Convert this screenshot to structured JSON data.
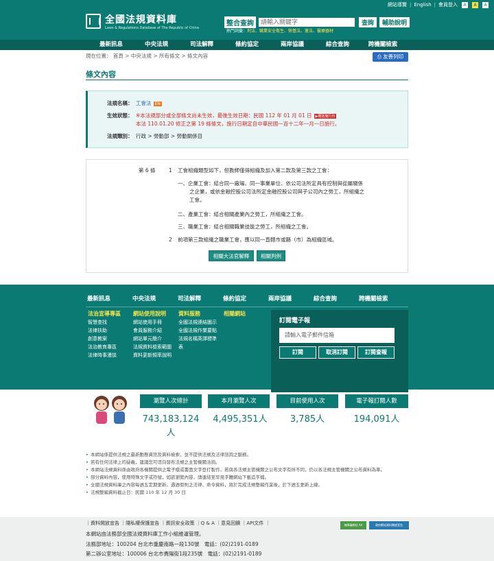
{
  "top": {
    "links": [
      "網站導覽",
      "English",
      "會員登入"
    ],
    "font_sizes": [
      "A",
      "A",
      "A"
    ]
  },
  "logo": {
    "title": "全國法規資料庫",
    "subtitle": "Laws & Regulations Database of The Republic of China"
  },
  "search": {
    "label": "整合查詢",
    "placeholder": "請輸入關鍵字",
    "query_button": "查詢",
    "help_button": "輔助說明",
    "hot_label": "熱門詞彙：",
    "hot_words": "刑法、職業安全衛生、勞基法、憲法、醫療器材"
  },
  "nav": [
    "最新訊息",
    "中央法規",
    "司法解釋",
    "條約協定",
    "兩岸協議",
    "綜合查詢",
    "跨機關檢索"
  ],
  "breadcrumb": "現在位置： 首頁 > 中央法規 > 所有條文 > 條文內容",
  "print_button": "友善列印",
  "page_title": "條文內容",
  "info": {
    "name_label": "法規名稱：",
    "name_value": "工會法",
    "en_badge": "EN",
    "status_label": "生效狀態：",
    "status_line1": "※本法規部分或全部條文尚未生效，最後生效日期：民國 112 年 01 月 01 日",
    "status_badge": "▶概括施行日",
    "status_line2": "本法 110.01.20 修正之第 19 條條文，施行日期定自中華民國一百十二年一月一日施行。",
    "category_label": "法規類別：",
    "category_value": "行政 > 勞動部 > 勞動關係目"
  },
  "article": {
    "number": "第 6 條",
    "para1_no": "1",
    "para1": "工會組織類型如下，但教師僅得組織及加入第二款及第三款之工會：",
    "item1": "一、企業工會：結合同一廠場、同一事業單位、依公司法所定具有控制與從屬關係之企業，或依金融控股公司法所定金融控股公司與子公司內之勞工，所組織之工會。",
    "item1_lines": [
      "一、企業工會：結合同一廠場、同一事業單位、依公司法所定具有控制與從屬關係",
      "之企業，或依金融控股公司法所定金融控股公司與子公司內之勞工，所組織之",
      "工會。"
    ],
    "item2": "二、產業工會：結合相關產業內之勞工，所組織之工會。",
    "item3": "三、職業工會：結合相關職業技能之勞工，所組織之工會。",
    "para2_no": "2",
    "para2": "前項第三款組織之職業工會，應以同一直轄市或縣（市）為組織區域。",
    "btn_interp": "相關大法官解釋",
    "btn_judge": "相關判例"
  },
  "footer": {
    "nav": [
      "最新訊息",
      "中央法規",
      "司法解釋",
      "條約協定",
      "兩岸協議",
      "綜合查詢",
      "跨機關檢索"
    ],
    "col1": {
      "head": "法治宣導專區",
      "items": [
        "智慧查找",
        "法律扶助",
        "創意教案",
        "法治教育專區",
        "法律時事漫談"
      ]
    },
    "col2": {
      "head": "網站使用說明",
      "items": [
        "網站使用手冊",
        "會員服務介紹",
        "網站單元簡介",
        "法規資料檢索範圍",
        "資料更新頻率說明"
      ]
    },
    "col3": {
      "head": "資料服務",
      "items": [
        "全國法規連結圖示",
        "全國法規作業要點",
        "法規名稱英譯標準表"
      ]
    },
    "col4": {
      "head": "相關網站"
    },
    "subscribe": {
      "title": "訂閱電子報",
      "placeholder": "請輸入電子郵件信箱",
      "subscribe": "訂閱",
      "cancel": "取消訂閱",
      "past": "訂閱查報"
    }
  },
  "stats": [
    {
      "label": "瀏覽人次總計",
      "value": "743,183,124人"
    },
    {
      "label": "本月瀏覽人次",
      "value": "4,495,351人"
    },
    {
      "label": "目前使用人次",
      "value": "3,785人"
    },
    {
      "label": "電子報訂閱人數",
      "value": "194,091人"
    }
  ],
  "notes": [
    "本網站係提供法規之最新動態資訊及資料檢索，並不提供法規及法律諮詢之服務。",
    "若有任何法律上的疑義，建議您可逕向發布法規之主管機關洽詢。",
    "本網站法規資料係由政府各機關提供之電子檔或書面文字登打製作，若與各法規主管機關之公布文字有所不同，仍以各法規主管機關之公布資料為準。",
    "部分資料內容，使用特殊文字或符號，如欲瀏覽內容，請連結至罕見字體網站下載造字檔。",
    "全國法規資料庫之內容每週五定期更新，遇週假則之法律、命令資料，將於完成法規整編作業後，於下週五更新上線。",
    "法規整編資料截止日：民國 110 年 12 月 30 日"
  ],
  "bottom": {
    "links": "｜資料開放宣告 ｜隱私權保護宣告 ｜資訊安全政策 ｜Q & A ｜意見回饋 ｜API文件 ｜",
    "owner": "本網站由法務部全國法規資料庫工作小組維運管理。",
    "addr1": "法務部地址：100204 台北市重慶南路一段130號　電話：(02)2191-0189",
    "addr2": "第二辦公室地址：100006 台北市貴陽街1段235號　電話：(02)2191-0189",
    "badge1": "無障礙網站 AA",
    "badge2": "政府網站資料開放宣告"
  }
}
